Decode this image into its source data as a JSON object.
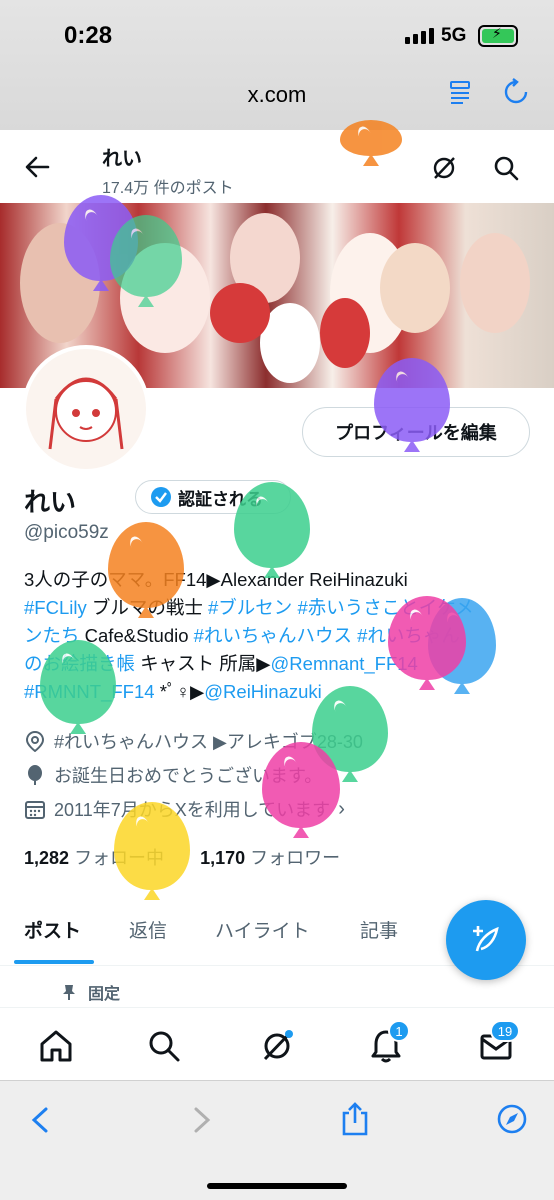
{
  "status_bar": {
    "time": "0:28",
    "network": "5G"
  },
  "browser": {
    "url": "x.com"
  },
  "header": {
    "name": "れい",
    "post_count": "17.4万 件のポスト"
  },
  "profile": {
    "edit_label": "プロフィールを編集",
    "display_name": "れい",
    "verified_label": "認証される",
    "handle": "@pico59z",
    "bio": {
      "line1": "3人の子のママ。FF14▶Alexander ReiHinazuki",
      "l2_a": "#FCLily",
      "l2_b": " ブルマの戦士 ",
      "l2_c": "#ブルセン",
      "l2_d": " ",
      "l2_e": "#赤いうさことイケメ",
      "l3_a": "ンたち",
      "l3_b": " Cafe&Studio ",
      "l3_c": "#れいちゃんハウス",
      "l3_d": " ",
      "l3_e": "#れいちゃん",
      "l4_a": "のお絵描き帳",
      "l4_b": " キャスト 所属▶",
      "l4_c": "@Remnant_FF14",
      "l5_a": "#RMNNT_FF14",
      "l5_b": " *ﾟ♀▶",
      "l5_c": "@ReiHinazuki"
    },
    "location": "#れいちゃんハウス ▶アレキゴブ28-30",
    "birthday": "お誕生日おめでとうございます。",
    "joined": "2011年7月からXを利用しています",
    "following_count": "1,282",
    "following_label": "フォロー中",
    "followers_count": "1,170",
    "followers_label": "フォロワー"
  },
  "tabs": [
    "ポスト",
    "返信",
    "ハイライト",
    "記事"
  ],
  "pinned_label": "固定",
  "bottom_nav": {
    "notifications_badge": "1",
    "messages_badge": "19"
  },
  "colors": {
    "accent": "#1d9bf0",
    "balloons": [
      "#f58220",
      "#8b5cf6",
      "#3ccf8e",
      "#ef3fa6",
      "#fcd626",
      "#3ba5f0"
    ]
  }
}
